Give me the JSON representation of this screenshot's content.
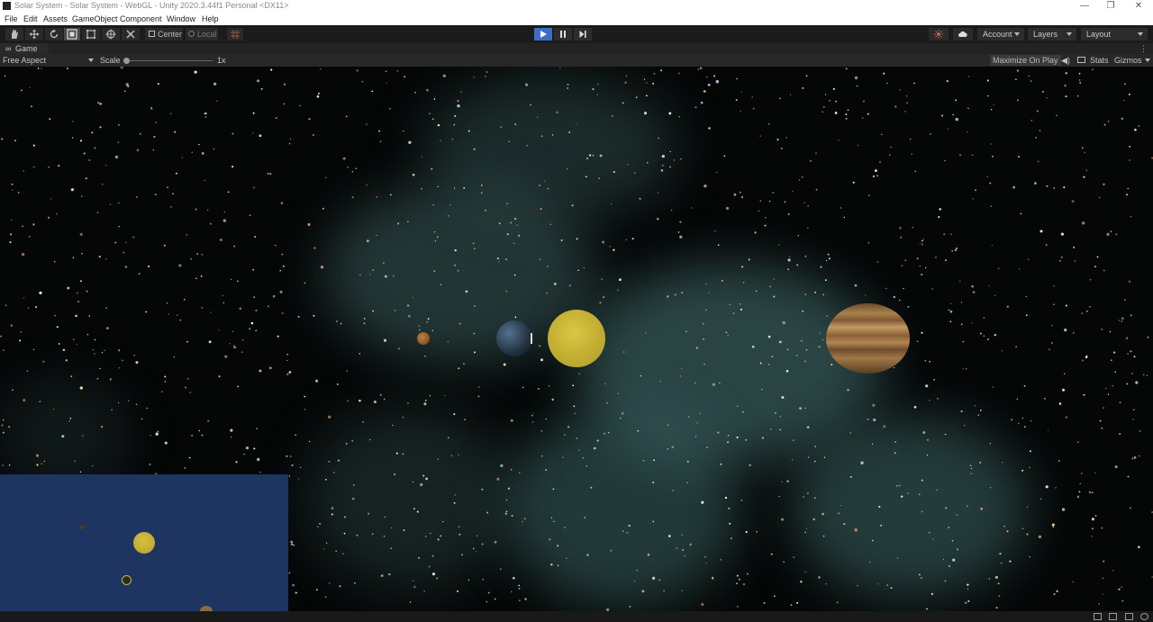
{
  "window": {
    "title": "Solar System - Solar System - WebGL - Unity 2020.3.44f1 Personal <DX11>",
    "controls": [
      "—",
      "❐",
      "✕"
    ]
  },
  "menu": [
    "File",
    "Edit",
    "Assets",
    "GameObject",
    "Component",
    "Window",
    "Help"
  ],
  "toolbar": {
    "tools": [
      "hand-tool-icon",
      "move-tool-icon",
      "rotate-tool-icon",
      "scale-tool-icon",
      "rect-tool-icon",
      "transform-tool-icon",
      "custom-tool-icon"
    ],
    "pivot_label": "Center",
    "space_label": "Local",
    "account_label": "Account",
    "layers_label": "Layers",
    "layout_label": "Layout",
    "play_active_color": "#3b6ec2"
  },
  "game_tab": {
    "label": "Game"
  },
  "game_toolbar": {
    "aspect": "Free Aspect",
    "scale_label": "Scale",
    "scale_value": "1x",
    "maximize_label": "Maximize On Play",
    "stats_label": "Stats",
    "gizmos_label": "Gizmos"
  },
  "scene": {
    "background_color": "#050707",
    "planets": [
      {
        "name": "mercury",
        "color": "#8a5a30"
      },
      {
        "name": "earth",
        "color": "#2f4a63"
      },
      {
        "name": "sun",
        "color": "#c9b535"
      },
      {
        "name": "jupiter",
        "color": "#a77a45"
      }
    ],
    "minimap": {
      "background": "#1d3560",
      "sun_color": "#c9b535"
    }
  }
}
